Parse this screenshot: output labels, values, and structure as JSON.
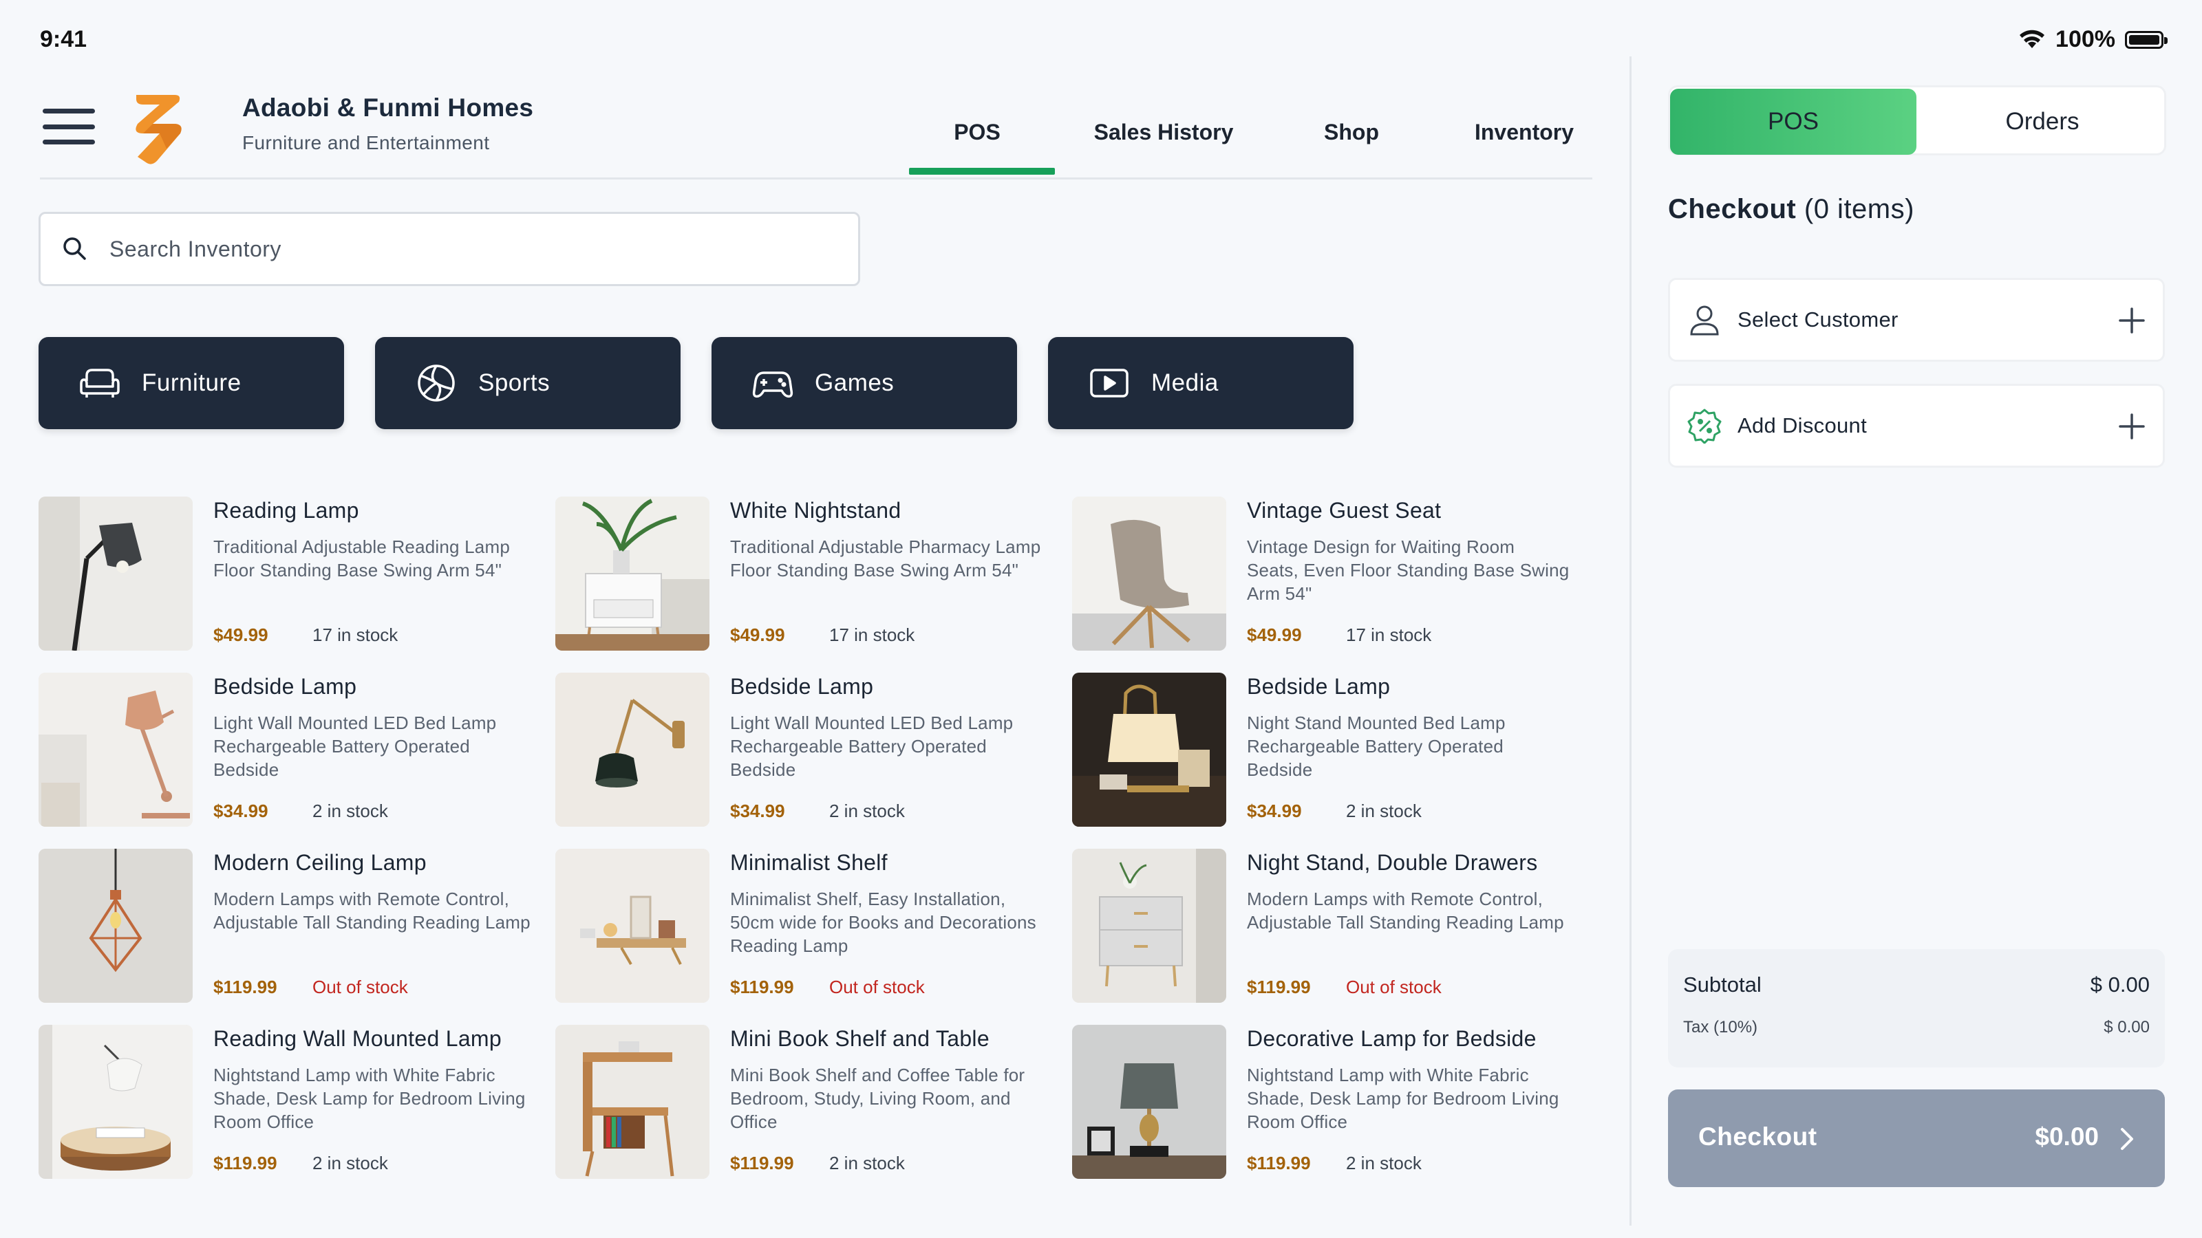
{
  "status_bar": {
    "time": "9:41",
    "battery": "100%"
  },
  "brand": {
    "name": "Adaobi & Funmi Homes",
    "tagline": "Furniture and Entertainment"
  },
  "nav": {
    "tabs": [
      {
        "label": "POS",
        "active": true
      },
      {
        "label": "Sales History"
      },
      {
        "label": "Shop"
      },
      {
        "label": "Inventory"
      }
    ]
  },
  "search": {
    "placeholder": "Search Inventory",
    "value": ""
  },
  "categories": [
    {
      "label": "Furniture",
      "icon": "sofa-icon"
    },
    {
      "label": "Sports",
      "icon": "ball-icon"
    },
    {
      "label": "Games",
      "icon": "gamepad-icon"
    },
    {
      "label": "Media",
      "icon": "play-icon"
    }
  ],
  "products": [
    {
      "name": "Reading Lamp",
      "description": "Traditional Adjustable Reading Lamp Floor Standing Base Swing Arm 54\"",
      "price": "$49.99",
      "stock": "17 in stock",
      "in_stock": true
    },
    {
      "name": "White Nightstand",
      "description": "Traditional Adjustable Pharmacy Lamp Floor Standing Base Swing Arm 54\"",
      "price": "$49.99",
      "stock": "17 in stock",
      "in_stock": true
    },
    {
      "name": "Vintage Guest Seat",
      "description": "Vintage Design for Waiting Room Seats, Even Floor Standing Base Swing Arm 54\"",
      "price": "$49.99",
      "stock": "17 in stock",
      "in_stock": true
    },
    {
      "name": "Bedside Lamp",
      "description": "Light Wall Mounted LED Bed Lamp Rechargeable Battery Operated Bedside",
      "price": "$34.99",
      "stock": "2 in stock",
      "in_stock": true
    },
    {
      "name": "Bedside Lamp",
      "description": "Light Wall Mounted LED Bed Lamp Rechargeable Battery Operated Bedside",
      "price": "$34.99",
      "stock": "2 in stock",
      "in_stock": true
    },
    {
      "name": "Bedside Lamp",
      "description": "Night Stand Mounted Bed Lamp Rechargeable Battery Operated Bedside",
      "price": "$34.99",
      "stock": "2 in stock",
      "in_stock": true
    },
    {
      "name": "Modern Ceiling Lamp",
      "description": "Modern Lamps with Remote Control, Adjustable Tall Standing Reading Lamp",
      "price": "$119.99",
      "stock": "Out of stock",
      "in_stock": false
    },
    {
      "name": "Minimalist Shelf",
      "description": "Minimalist Shelf, Easy Installation, 50cm wide for Books and Decorations Reading Lamp",
      "price": "$119.99",
      "stock": "Out of stock",
      "in_stock": false
    },
    {
      "name": "Night Stand, Double Drawers",
      "description": "Modern Lamps with Remote Control, Adjustable Tall Standing Reading Lamp",
      "price": "$119.99",
      "stock": "Out of stock",
      "in_stock": false
    },
    {
      "name": "Reading Wall Mounted Lamp",
      "description": "Nightstand Lamp with White Fabric Shade, Desk Lamp for Bedroom Living Room Office",
      "price": "$119.99",
      "stock": "2 in stock",
      "in_stock": true
    },
    {
      "name": "Mini Book Shelf and Table",
      "description": "Mini Book Shelf and Coffee Table for Bedroom, Study,  Living Room, and Office",
      "price": "$119.99",
      "stock": "2 in stock",
      "in_stock": true
    },
    {
      "name": "Decorative Lamp for Bedside",
      "description": "Nightstand Lamp with White Fabric Shade, Desk Lamp for Bedroom Living Room Office",
      "price": "$119.99",
      "stock": "2 in stock",
      "in_stock": true
    }
  ],
  "right_panel": {
    "segments": [
      {
        "label": "POS",
        "active": true
      },
      {
        "label": "Orders"
      }
    ],
    "checkout_title": "Checkout",
    "item_count": "(0 items)",
    "select_customer": "Select Customer",
    "add_discount": "Add Discount",
    "subtotal_label": "Subtotal",
    "subtotal_value": "$ 0.00",
    "tax_label": "Tax (10%)",
    "tax_value": "$ 0.00",
    "checkout_label": "Checkout",
    "checkout_total": "$0.00"
  },
  "colors": {
    "accent_green": "#17a05a",
    "category_bg": "#1f2a3b",
    "price": "#a3620a",
    "out_of_stock": "#c2261f",
    "checkout_btn": "#8f9bae"
  }
}
